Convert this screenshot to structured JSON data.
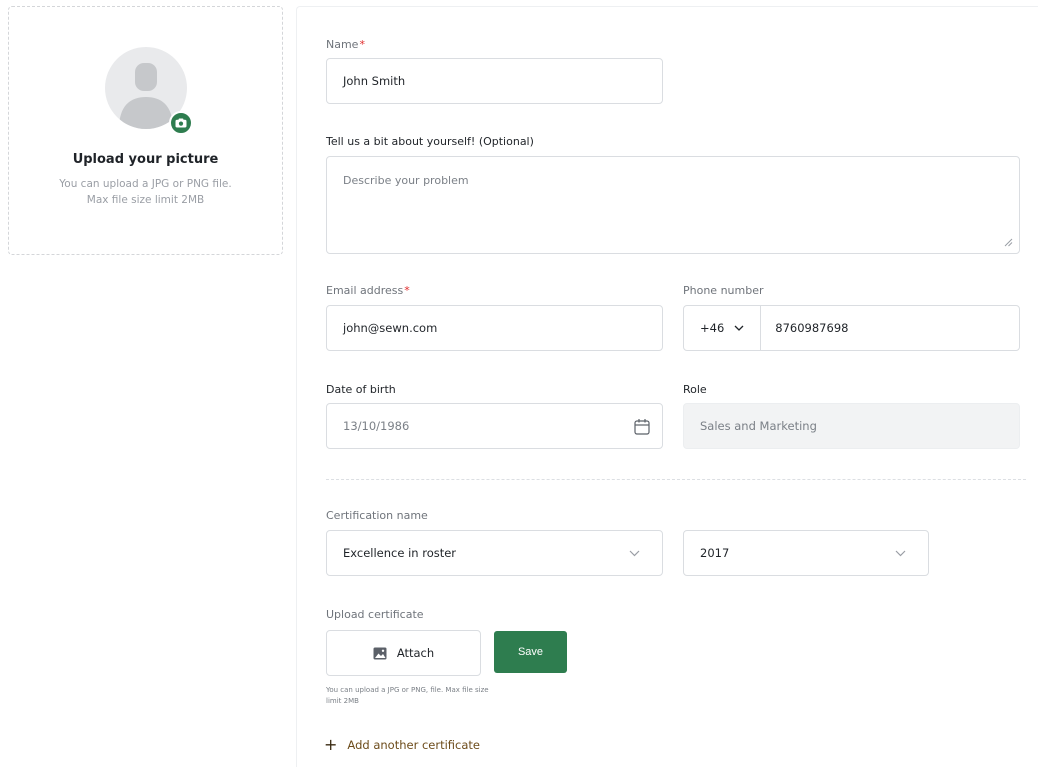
{
  "upload": {
    "title": "Upload your picture",
    "description": "You can upload a JPG or PNG file. Max file size limit 2MB"
  },
  "form": {
    "name": {
      "label": "Name",
      "required_mark": "*",
      "value": "John Smith"
    },
    "about": {
      "label": "Tell us a bit about yourself! (Optional)",
      "placeholder": "Describe your problem"
    },
    "email": {
      "label": "Email address",
      "required_mark": "*",
      "value": "john@sewn.com"
    },
    "phone": {
      "label": "Phone number",
      "country_code": "+46",
      "value": "8760987698"
    },
    "dob": {
      "label": "Date of birth",
      "value": "13/10/1986"
    },
    "role": {
      "label": "Role",
      "value": "Sales and Marketing"
    },
    "certification": {
      "label": "Certification name",
      "name_value": "Excellence in roster",
      "year_value": "2017"
    },
    "upload_certificate": {
      "label": "Upload certificate",
      "attach_label": "Attach",
      "save_label": "Save",
      "hint": "You can upload a JPG or PNG, file. Max file size limit 2MB"
    },
    "add_certificate_label": "Add another certificate"
  },
  "colors": {
    "accent": "#2e7d4f",
    "required": "#e02c2c",
    "link": "#6d4c1b"
  },
  "icons": {
    "avatar": "user-silhouette-icon",
    "camera": "camera-icon",
    "calendar": "calendar-icon",
    "chevron": "chevron-down-icon",
    "image": "image-icon",
    "plus": "plus-icon"
  }
}
